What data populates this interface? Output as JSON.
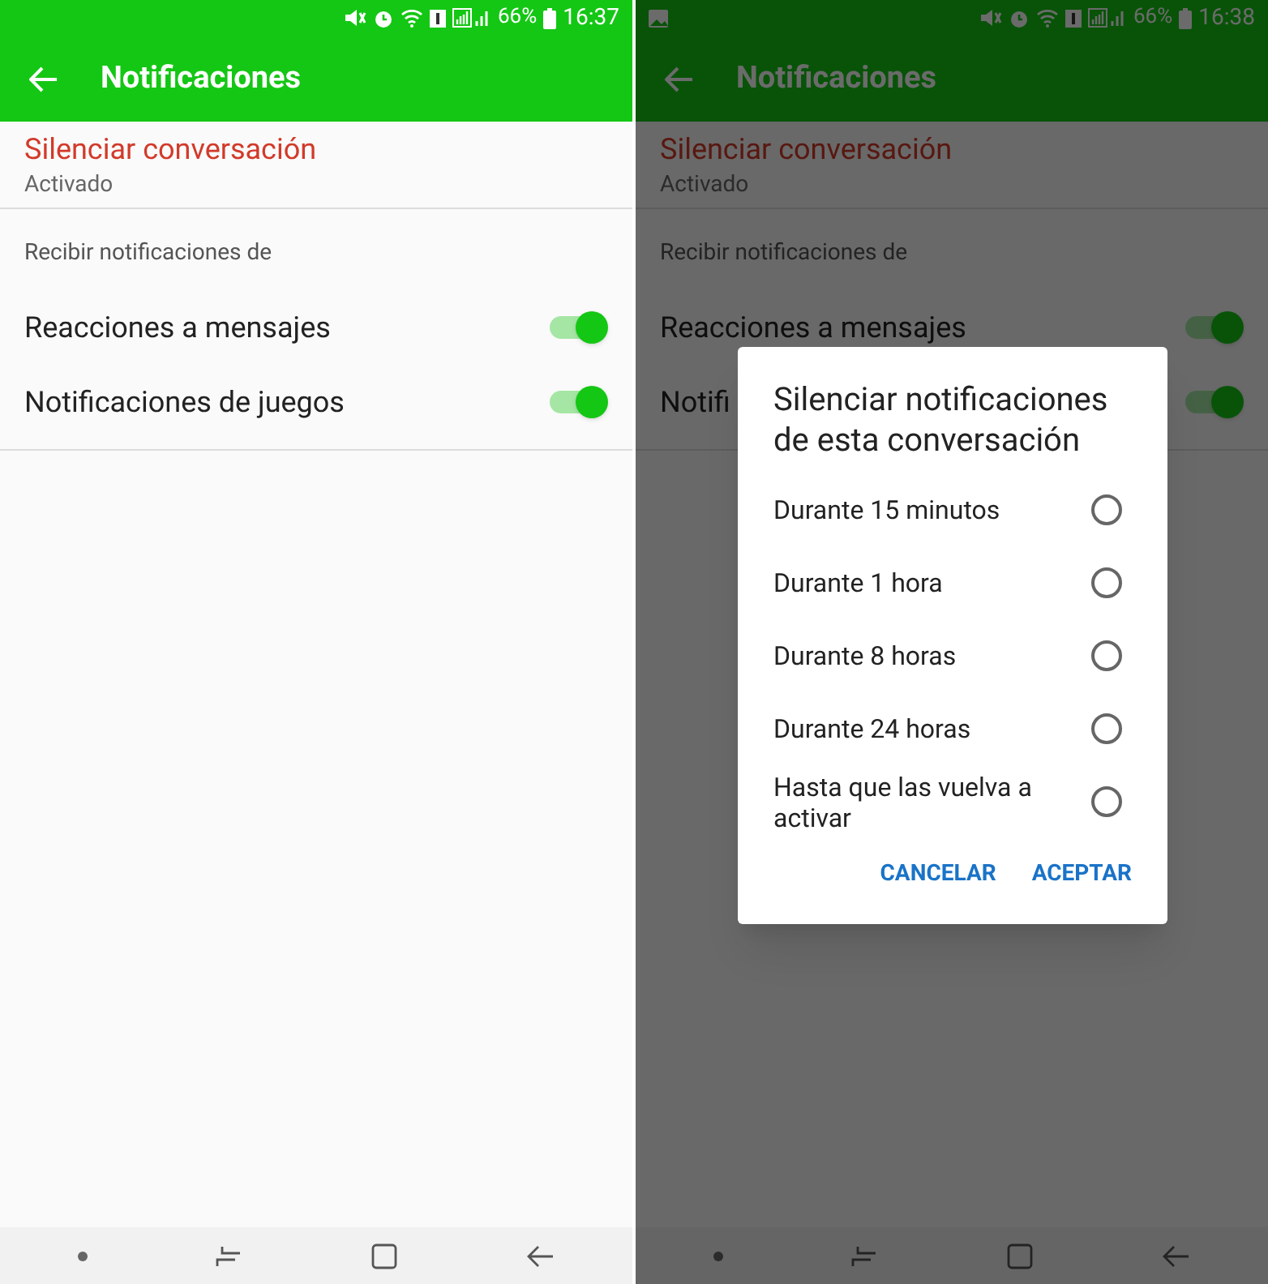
{
  "screens": [
    {
      "status_bar": {
        "picture_notification": false,
        "battery": "66%",
        "time": "16:37"
      },
      "app_bar": {
        "title": "Notificaciones"
      },
      "mute_setting": {
        "title": "Silenciar conversación",
        "value": "Activado"
      },
      "section_header": "Recibir notificaciones de",
      "toggles": [
        {
          "label": "Reacciones a mensajes",
          "on": true
        },
        {
          "label": "Notificaciones de juegos",
          "on": true
        }
      ]
    },
    {
      "status_bar": {
        "picture_notification": true,
        "battery": "66%",
        "time": "16:38"
      },
      "app_bar": {
        "title": "Notificaciones"
      },
      "mute_setting": {
        "title": "Silenciar conversación",
        "value": "Activado"
      },
      "section_header": "Recibir notificaciones de",
      "toggles": [
        {
          "label": "Reacciones a mensajes",
          "on": true
        },
        {
          "label": "Notifi",
          "on": true
        }
      ],
      "dialog": {
        "title": "Silenciar notificaciones de esta conversación",
        "options": [
          {
            "label": "Durante 15 minutos",
            "selected": false
          },
          {
            "label": "Durante 1 hora",
            "selected": false
          },
          {
            "label": "Durante 8 horas",
            "selected": false
          },
          {
            "label": "Durante 24 horas",
            "selected": false
          },
          {
            "label": "Hasta que las vuelva a activar",
            "selected": false
          }
        ],
        "buttons": [
          "CANCELAR",
          "ACEPTAR"
        ]
      }
    }
  ]
}
